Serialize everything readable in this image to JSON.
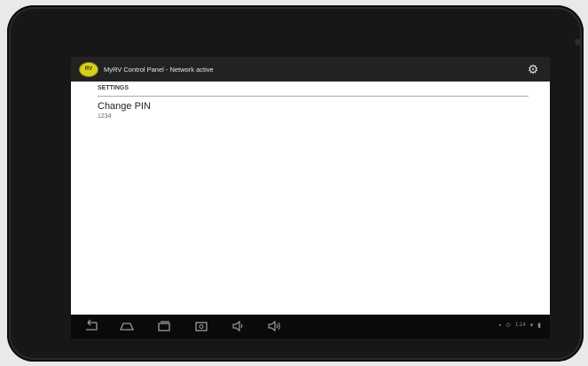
{
  "app": {
    "title": "MyRV Control Panel - Network active",
    "logo_text": "RV"
  },
  "settings": {
    "section_header": "SETTINGS",
    "items": [
      {
        "title": "Change PIN",
        "summary": "1234"
      }
    ]
  },
  "icons": {
    "settings": "gear-icon",
    "nav": [
      "back-icon",
      "home-icon",
      "recent-apps-icon",
      "screenshot-icon",
      "volume-down-icon",
      "volume-up-icon"
    ],
    "status": [
      "notification-icon",
      "wifi-icon",
      "battery-icon"
    ]
  },
  "status_bar": {
    "time": "1:14"
  },
  "colors": {
    "action_bar": "#222222",
    "logo": "#d9cf1c",
    "nav_bar": "#0a0a0a",
    "divider": "#a9a9a9"
  }
}
